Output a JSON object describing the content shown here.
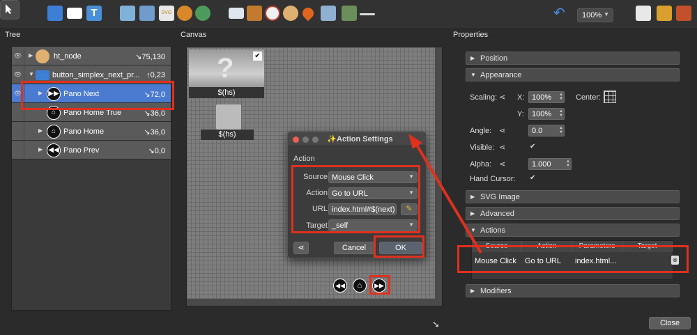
{
  "toolbar": {
    "zoom": "100%",
    "tools": [
      "pointer-icon",
      "folder-icon",
      "rectangle-icon",
      "text-icon",
      "image-icon",
      "image-button-icon",
      "svg-icon",
      "globe-icon",
      "world-map-icon",
      "screen-icon",
      "grid-icon",
      "compass-icon",
      "compass-rose-icon",
      "map-pin-icon",
      "map-icon",
      "video-icon",
      "slider-icon",
      "undo-icon",
      "search-file-icon",
      "edit-shapes-icon",
      "factory-icon"
    ]
  },
  "panels": {
    "tree": "Tree",
    "canvas": "Canvas",
    "properties": "Properties"
  },
  "tree": {
    "rows": [
      {
        "label": "ht_node",
        "value": "↘75,130",
        "icon": "compass-icon"
      },
      {
        "label": "button_simplex_next_pr...",
        "value": "↑0,23",
        "icon": "folder-icon"
      },
      {
        "label": "Pano Next",
        "value": "↘72,0",
        "icon": "fast-forward-icon",
        "selected": true
      },
      {
        "label": "Pano Home True",
        "value": "↘36,0",
        "icon": "home-icon"
      },
      {
        "label": "Pano Home",
        "value": "↘36,0",
        "icon": "home-icon"
      },
      {
        "label": "Pano Prev",
        "value": "↘0,0",
        "icon": "rewind-icon"
      }
    ]
  },
  "canvas": {
    "hs_label_1": "$(hs)",
    "hs_label_2": "$(hs)"
  },
  "dialog": {
    "title": "Action Settings",
    "section": "Action",
    "source_label": "Source:",
    "source_value": "Mouse Click",
    "action_label": "Action:",
    "action_value": "Go to URL",
    "url_label": "URL:",
    "url_value": "index.html#$(next)",
    "target_label": "Target:",
    "target_value": "_self",
    "cancel": "Cancel",
    "ok": "OK"
  },
  "properties": {
    "position": "Position",
    "appearance": "Appearance",
    "scaling_label": "Scaling:",
    "x_label": "X:",
    "x_value": "100%",
    "y_label": "Y:",
    "y_value": "100%",
    "center_label": "Center:",
    "angle_label": "Angle:",
    "angle_value": "0.0",
    "visible_label": "Visible:",
    "visible_checked": true,
    "alpha_label": "Alpha:",
    "alpha_value": "1.000",
    "hand_cursor_label": "Hand Cursor:",
    "hand_cursor_checked": true,
    "svg_image": "SVG Image",
    "advanced": "Advanced",
    "actions": "Actions",
    "modifiers": "Modifiers",
    "actions_table": {
      "headers": [
        "Source",
        "Action",
        "Parameters",
        "Target"
      ],
      "row": [
        "Mouse Click",
        "Go to URL",
        "index.html...",
        ""
      ]
    }
  },
  "footer": {
    "close": "Close"
  },
  "colors": {
    "highlight": "#e0301e",
    "selected": "#4a7bd0"
  }
}
